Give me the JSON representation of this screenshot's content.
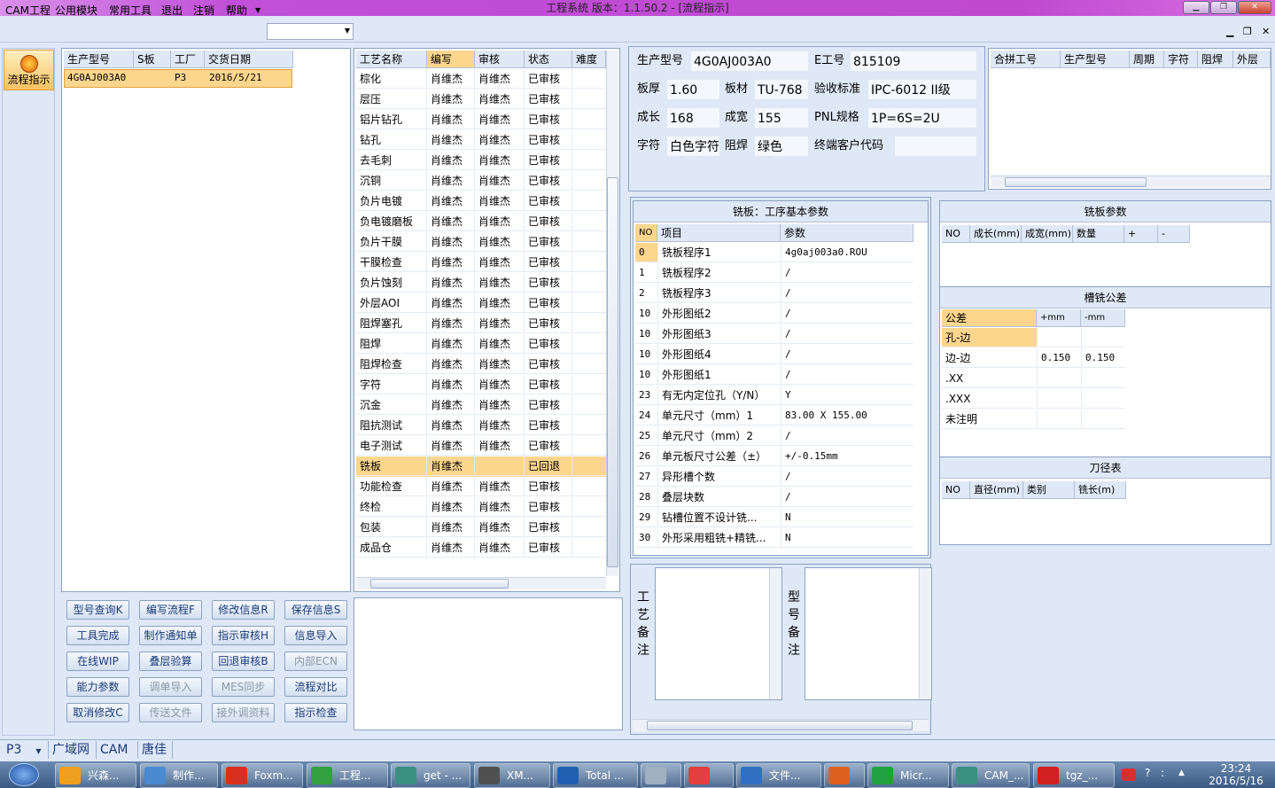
{
  "window": {
    "title": "工程系统   版本：1.1.50.2 - [流程指示]"
  },
  "menu": {
    "items": [
      "CAM工程",
      "公用模块",
      "常用工具",
      "退出",
      "注销",
      "帮助"
    ]
  },
  "nav": {
    "label": "流程指示"
  },
  "orders": {
    "headers": [
      "生产型号",
      "S板",
      "工厂",
      "交货日期"
    ],
    "rows": [
      [
        "4G0AJ003A0",
        "",
        "P3",
        "2016/5/21"
      ]
    ]
  },
  "process": {
    "headers": [
      "工艺名称",
      "编写",
      "审核",
      "状态",
      "难度"
    ],
    "rows": [
      [
        "棕化",
        "肖维杰",
        "肖维杰",
        "已审核"
      ],
      [
        "层压",
        "肖维杰",
        "肖维杰",
        "已审核"
      ],
      [
        "铝片钻孔",
        "肖维杰",
        "肖维杰",
        "已审核"
      ],
      [
        "钻孔",
        "肖维杰",
        "肖维杰",
        "已审核"
      ],
      [
        "去毛刺",
        "肖维杰",
        "肖维杰",
        "已审核"
      ],
      [
        "沉铜",
        "肖维杰",
        "肖维杰",
        "已审核"
      ],
      [
        "负片电镀",
        "肖维杰",
        "肖维杰",
        "已审核"
      ],
      [
        "负电镀磨板",
        "肖维杰",
        "肖维杰",
        "已审核"
      ],
      [
        "负片干膜",
        "肖维杰",
        "肖维杰",
        "已审核"
      ],
      [
        "干膜检查",
        "肖维杰",
        "肖维杰",
        "已审核"
      ],
      [
        "负片蚀刻",
        "肖维杰",
        "肖维杰",
        "已审核"
      ],
      [
        "外层AOI",
        "肖维杰",
        "肖维杰",
        "已审核"
      ],
      [
        "阻焊塞孔",
        "肖维杰",
        "肖维杰",
        "已审核"
      ],
      [
        "阻焊",
        "肖维杰",
        "肖维杰",
        "已审核"
      ],
      [
        "阻焊检查",
        "肖维杰",
        "肖维杰",
        "已审核"
      ],
      [
        "字符",
        "肖维杰",
        "肖维杰",
        "已审核"
      ],
      [
        "沉金",
        "肖维杰",
        "肖维杰",
        "已审核"
      ],
      [
        "阻抗测试",
        "肖维杰",
        "肖维杰",
        "已审核"
      ],
      [
        "电子测试",
        "肖维杰",
        "肖维杰",
        "已审核"
      ],
      [
        "铣板",
        "肖维杰",
        "",
        "已回退"
      ],
      [
        "功能检查",
        "肖维杰",
        "肖维杰",
        "已审核"
      ],
      [
        "终检",
        "肖维杰",
        "肖维杰",
        "已审核"
      ],
      [
        "包装",
        "肖维杰",
        "肖维杰",
        "已审核"
      ],
      [
        "成品仓",
        "肖维杰",
        "肖维杰",
        "已审核"
      ]
    ],
    "selected_index": 19
  },
  "buttons": [
    [
      "型号查询K",
      "编写流程F",
      "修改信息R",
      "保存信息S"
    ],
    [
      "工具完成",
      "制作通知单",
      "指示审核H",
      "信息导入"
    ],
    [
      "在线WIP",
      "叠层验算",
      "回退审核B",
      "内部ECN"
    ],
    [
      "能力参数",
      "调单导入",
      "MES同步",
      "流程对比"
    ],
    [
      "取消修改C",
      "传送文件",
      "接外调资料",
      "指示检查"
    ]
  ],
  "buttons_disabled": [
    "内部ECN",
    "调单导入",
    "MES同步",
    "传送文件",
    "接外调资料"
  ],
  "info": {
    "prod_model_label": "生产型号",
    "prod_model": "4G0AJ003A0",
    "e_no_label": "E工号",
    "e_no": "815109",
    "thickness_label": "板厚",
    "thickness": "1.60",
    "material_label": "板材",
    "material": "TU-768",
    "std_label": "验收标准",
    "std": "IPC-6012 II级",
    "length_label": "成长",
    "length": "168",
    "width_label": "成宽",
    "width": "155",
    "pnl_label": "PNL规格",
    "pnl": "1P=6S=2U",
    "char_label": "字符",
    "char": "白色字符",
    "mask_label": "阻焊",
    "mask": "绿色",
    "customer_label": "终端客户代码",
    "customer": ""
  },
  "combine": {
    "headers": [
      "合拼工号",
      "生产型号",
      "周期",
      "字符",
      "阻焊",
      "外层"
    ]
  },
  "params": {
    "title": "铣板：工序基本参数",
    "headers": [
      "NO",
      "项目",
      "参数"
    ],
    "rows": [
      [
        "0",
        "铣板程序1",
        "4g0aj003a0.ROU"
      ],
      [
        "1",
        "铣板程序2",
        "/"
      ],
      [
        "2",
        "铣板程序3",
        "/"
      ],
      [
        "10",
        "外形图纸2",
        "/"
      ],
      [
        "10",
        "外形图纸3",
        "/"
      ],
      [
        "10",
        "外形图纸4",
        "/"
      ],
      [
        "10",
        "外形图纸1",
        "/"
      ],
      [
        "23",
        "有无内定位孔（Y/N）",
        "Y"
      ],
      [
        "24",
        "单元尺寸（mm）1",
        "83.00 X 155.00"
      ],
      [
        "25",
        "单元尺寸（mm）2",
        "/"
      ],
      [
        "26",
        "单元板尺寸公差（±）",
        "+/-0.15mm"
      ],
      [
        "27",
        "异形槽个数",
        "/"
      ],
      [
        "28",
        "叠层块数",
        "/"
      ],
      [
        "29",
        "钻槽位置不设计铣...",
        "N"
      ],
      [
        "30",
        "外形采用粗铣+精铣...",
        "N"
      ]
    ]
  },
  "mill_params": {
    "title": "铣板参数",
    "headers": [
      "NO",
      "成长(mm)",
      "成宽(mm)",
      "数量",
      "+",
      "-"
    ]
  },
  "slot_tol": {
    "title": "槽铣公差",
    "headers": [
      "公差",
      "+mm",
      "-mm"
    ],
    "rows": [
      [
        "孔-边",
        "",
        ""
      ],
      [
        "边-边",
        "0.150",
        "0.150"
      ],
      [
        ".XX",
        "",
        ""
      ],
      [
        ".XXX",
        "",
        ""
      ],
      [
        "未注明",
        "",
        ""
      ]
    ]
  },
  "tools": {
    "title": "刀径表",
    "headers": [
      "NO",
      "直径(mm)",
      "类别",
      "铣长(m)"
    ]
  },
  "remarks": {
    "proc_label": "工艺备注",
    "model_label": "型号备注"
  },
  "status": {
    "site": "P3",
    "items": [
      "广域网",
      "CAM",
      "唐佳"
    ]
  },
  "taskbar": {
    "items": [
      "兴森...",
      "制作...",
      "Foxm...",
      "工程...",
      "get - ...",
      "XM...",
      "Total ...",
      "",
      "",
      "文件...",
      "",
      "Micr...",
      "CAM_...",
      "tgz_..."
    ],
    "clock": "23:24",
    "date": "2016/5/16"
  },
  "colors": {
    "accent": "#f8c060",
    "select": "#fcd68c",
    "panel": "#dfe8f6"
  }
}
